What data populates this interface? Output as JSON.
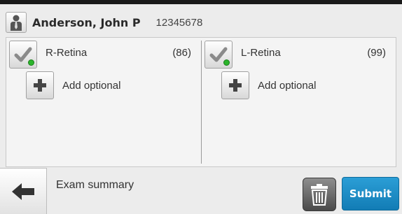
{
  "patient": {
    "name": "Anderson, John P",
    "id": "12345678",
    "icon": "person-icon"
  },
  "left_eye": {
    "label": "R-Retina",
    "count": "(86)",
    "add_label": "Add optional"
  },
  "right_eye": {
    "label": "L-Retina",
    "count": "(99)",
    "add_label": "Add optional"
  },
  "footer": {
    "title": "Exam summary",
    "submit_label": "Submit"
  },
  "colors": {
    "accent": "#1a8ccc",
    "status_ok": "#2bb52b",
    "topbar": "#1a1a1a"
  }
}
